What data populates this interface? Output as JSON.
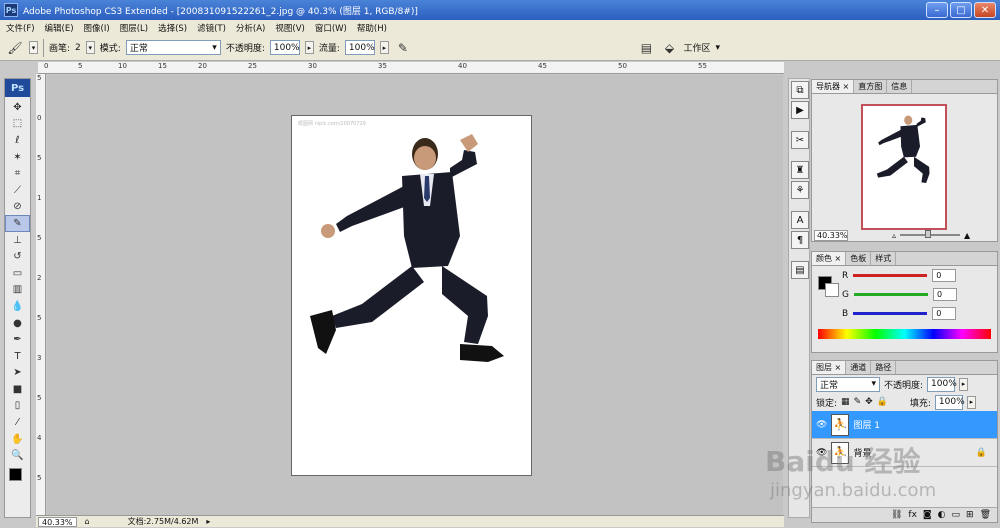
{
  "window": {
    "app_icon": "Ps",
    "title": "Adobe Photoshop CS3 Extended - [200831091522261_2.jpg @ 40.3% (图层 1, RGB/8#)]",
    "buttons": [
      "minimize-icon",
      "maximize-icon",
      "close-icon"
    ]
  },
  "menu": [
    "文件(F)",
    "编辑(E)",
    "图像(I)",
    "图层(L)",
    "选择(S)",
    "滤镜(T)",
    "分析(A)",
    "视图(V)",
    "窗口(W)",
    "帮助(H)"
  ],
  "options": {
    "brush_label": "画笔:",
    "brush_size": "2",
    "mode_label": "模式:",
    "mode_value": "正常",
    "opacity_label": "不透明度:",
    "opacity_value": "100%",
    "flow_label": "流量:",
    "flow_value": "100%",
    "workspace_label": "工作区"
  },
  "toolbox": {
    "ps_label": "Ps",
    "tools": [
      "move-tool-icon",
      "marquee-tool-icon",
      "lasso-tool-icon",
      "magic-wand-icon",
      "crop-tool-icon",
      "slice-tool-icon",
      "healing-brush-icon",
      "brush-tool-icon",
      "clone-stamp-icon",
      "history-brush-icon",
      "eraser-tool-icon",
      "gradient-tool-icon",
      "blur-tool-icon",
      "dodge-tool-icon",
      "pen-tool-icon",
      "type-tool-icon",
      "path-selection-icon",
      "shape-tool-icon",
      "notes-tool-icon",
      "eyedropper-icon",
      "hand-tool-icon",
      "zoom-tool-icon"
    ],
    "active_tool": "brush-tool-icon"
  },
  "rulers": {
    "top": [
      "0",
      "5",
      "10",
      "15",
      "20",
      "25",
      "30",
      "35",
      "40",
      "45",
      "50",
      "55"
    ],
    "left": [
      "5",
      "0",
      "5",
      "1",
      "5",
      "2",
      "5",
      "3",
      "5",
      "4",
      "5"
    ]
  },
  "document": {
    "watermark": "昵图网 nipic.com/20070729"
  },
  "status": {
    "zoom": "40.33%",
    "doc_size": "文档:2.75M/4.62M"
  },
  "navigator": {
    "tabs": [
      "导航器",
      "直方图",
      "信息"
    ],
    "zoom": "40.33%"
  },
  "color": {
    "tabs": [
      "颜色",
      "色板",
      "样式"
    ],
    "r_label": "R",
    "r_value": "0",
    "g_label": "G",
    "g_value": "0",
    "b_label": "B",
    "b_value": "0",
    "colors": {
      "r": "#cc2222",
      "g": "#22aa22",
      "b": "#2222cc"
    }
  },
  "layers": {
    "tabs": [
      "图层",
      "通道",
      "路径"
    ],
    "blend_mode": "正常",
    "opacity_label": "不透明度:",
    "opacity_value": "100%",
    "lock_label": "锁定:",
    "fill_label": "填充:",
    "fill_value": "100%",
    "rows": [
      {
        "name": "图层 1",
        "selected": true
      },
      {
        "name": "背景",
        "selected": false
      }
    ],
    "footer": [
      "link-icon",
      "fx-icon",
      "mask-icon",
      "adjustment-icon",
      "group-icon",
      "new-layer-icon",
      "trash-icon"
    ],
    "selection_color": "#3399ff"
  },
  "overlay_watermark": [
    "Baidu 经验",
    "jingyan.baidu.com"
  ]
}
